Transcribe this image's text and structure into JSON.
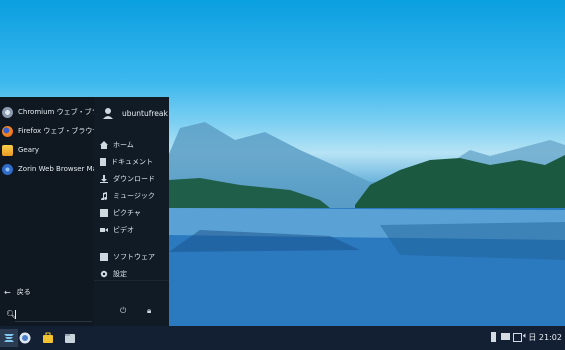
{
  "menu": {
    "apps": [
      {
        "label": "Chromium ウェブ・ブラウザ",
        "icon": "chromium-icon",
        "color": "#9aa6b8"
      },
      {
        "label": "Firefox ウェブ・ブラウザ",
        "icon": "firefox-icon",
        "color": "#f28b1e"
      },
      {
        "label": "Geary",
        "icon": "geary-icon",
        "color": "#f4b534"
      },
      {
        "label": "Zorin Web Browser Man...",
        "icon": "web-browser-manager-icon",
        "color": "#3d7ad6"
      }
    ],
    "user": "ubuntufreak",
    "places": [
      {
        "label": "ホーム",
        "icon": "home-icon"
      },
      {
        "label": "ドキュメント",
        "icon": "document-icon"
      },
      {
        "label": "ダウンロード",
        "icon": "download-icon"
      },
      {
        "label": "ミュージック",
        "icon": "music-icon"
      },
      {
        "label": "ピクチャ",
        "icon": "picture-icon"
      },
      {
        "label": "ビデオ",
        "icon": "video-icon"
      }
    ],
    "system": [
      {
        "label": "ソフトウェア",
        "icon": "software-icon"
      },
      {
        "label": "設定",
        "icon": "settings-icon"
      }
    ],
    "back_label": "戻る",
    "search_placeholder": ""
  },
  "taskbar": {
    "clock": "日 21:02",
    "launchers": [
      "zorin-menu-icon",
      "browser-icon",
      "software-store-icon",
      "files-icon"
    ]
  }
}
